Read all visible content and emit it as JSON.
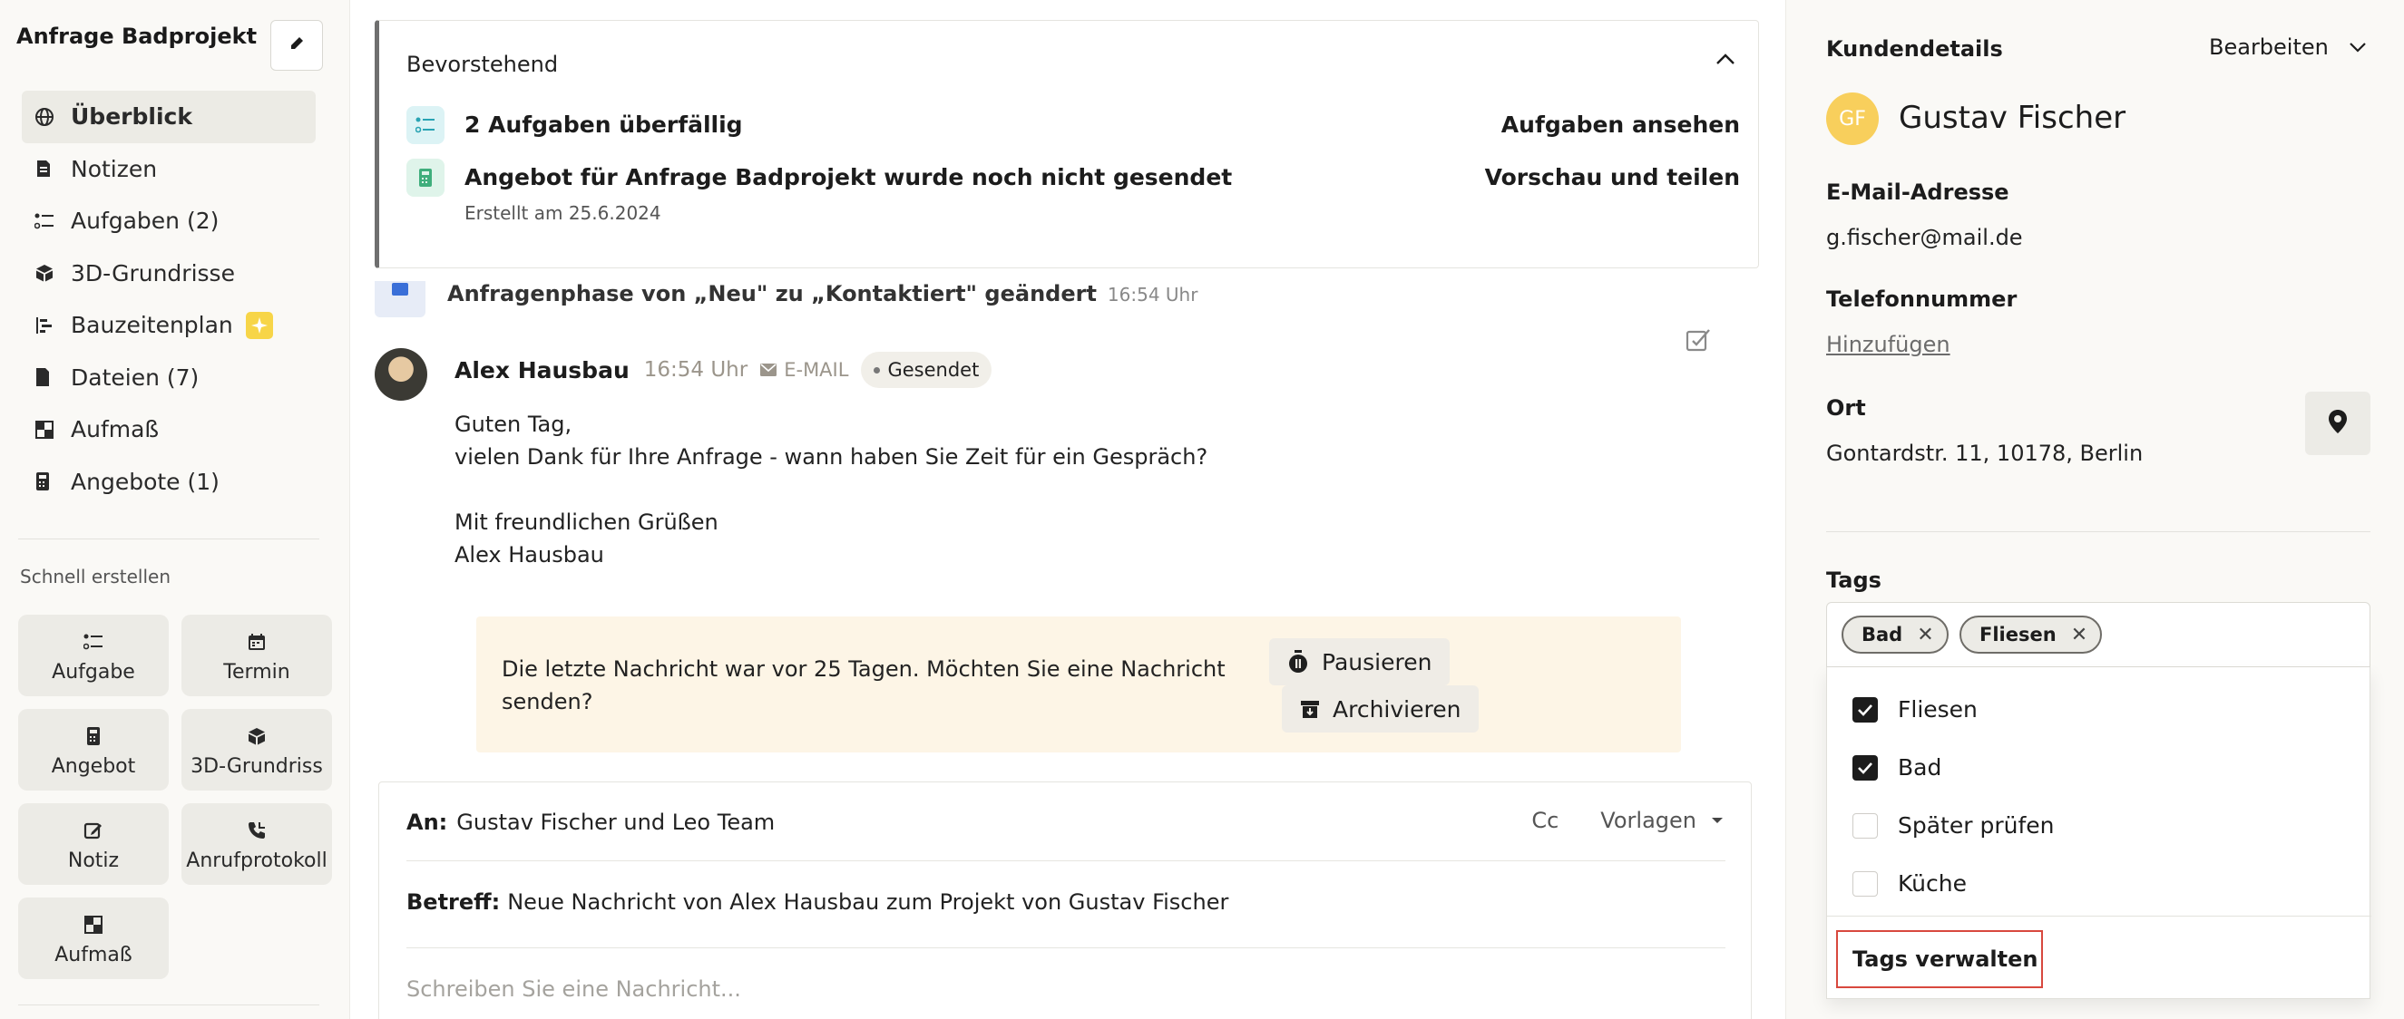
{
  "sidebar": {
    "project_title": "Anfrage Badprojekt",
    "nav": [
      {
        "label": "Überblick",
        "icon": "globe-icon",
        "active": true
      },
      {
        "label": "Notizen",
        "icon": "note-icon"
      },
      {
        "label": "Aufgaben (2)",
        "icon": "task-list-icon"
      },
      {
        "label": "3D-Grundrisse",
        "icon": "cube-icon"
      },
      {
        "label": "Bauzeitenplan",
        "icon": "gantt-icon"
      },
      {
        "label": "Dateien (7)",
        "icon": "file-icon"
      },
      {
        "label": "Aufmaß",
        "icon": "measure-icon"
      },
      {
        "label": "Angebote (1)",
        "icon": "calculator-icon"
      }
    ],
    "quick_create_title": "Schnell erstellen",
    "quick_create": [
      {
        "label": "Aufgabe",
        "icon": "task-list-icon"
      },
      {
        "label": "Termin",
        "icon": "calendar-icon"
      },
      {
        "label": "Angebot",
        "icon": "calculator-icon"
      },
      {
        "label": "3D-Grundriss",
        "icon": "cube-icon"
      },
      {
        "label": "Notiz",
        "icon": "edit-note-icon"
      },
      {
        "label": "Anrufprotokoll",
        "icon": "phone-icon"
      },
      {
        "label": "Aufmaß",
        "icon": "measure-icon"
      }
    ]
  },
  "upcoming": {
    "title": "Bevorstehend",
    "items": [
      {
        "text": "2 Aufgaben überfällig",
        "action": "Aufgaben ansehen"
      },
      {
        "text": "Angebot für Anfrage Badprojekt wurde noch nicht gesendet",
        "sub": "Erstellt am 25.6.2024",
        "action": "Vorschau und teilen"
      }
    ]
  },
  "timeline": {
    "phase_text": "Anfragenphase von „Neu\" zu „Kontaktiert\" geändert",
    "phase_time": "16:54 Uhr"
  },
  "message": {
    "author": "Alex Hausbau",
    "time": "16:54 Uhr",
    "channel": "E-MAIL",
    "status": "Gesendet",
    "lines": [
      "Guten Tag,",
      "vielen Dank für Ihre Anfrage - wann haben Sie Zeit für ein Gespräch?",
      "",
      "Mit freundlichen Grüßen",
      "Alex Hausbau"
    ]
  },
  "notice": {
    "text": "Die letzte Nachricht war vor 25 Tagen. Möchten Sie eine Nachricht senden?",
    "pause_label": "Pausieren",
    "archive_label": "Archivieren"
  },
  "compose": {
    "to_label": "An:",
    "to_value": "Gustav Fischer und Leo Team",
    "cc_label": "Cc",
    "templates_label": "Vorlagen",
    "subject_label": "Betreff:",
    "subject_value": "Neue Nachricht von Alex Hausbau zum Projekt von Gustav Fischer",
    "placeholder": "Schreiben Sie eine Nachricht..."
  },
  "customer": {
    "title": "Kundendetails",
    "edit_label": "Bearbeiten",
    "initials": "GF",
    "name": "Gustav Fischer",
    "email_label": "E-Mail-Adresse",
    "email": "g.fischer@mail.de",
    "phone_label": "Telefonnummer",
    "phone_add": "Hinzufügen",
    "location_label": "Ort",
    "location": "Gontardstr. 11, 10178, Berlin",
    "tags_label": "Tags",
    "tags": [
      "Bad",
      "Fliesen"
    ],
    "tag_options": [
      {
        "label": "Fliesen",
        "checked": true
      },
      {
        "label": "Bad",
        "checked": true
      },
      {
        "label": "Später prüfen",
        "checked": false
      },
      {
        "label": "Küche",
        "checked": false
      }
    ],
    "manage_tags": "Tags verwalten"
  }
}
